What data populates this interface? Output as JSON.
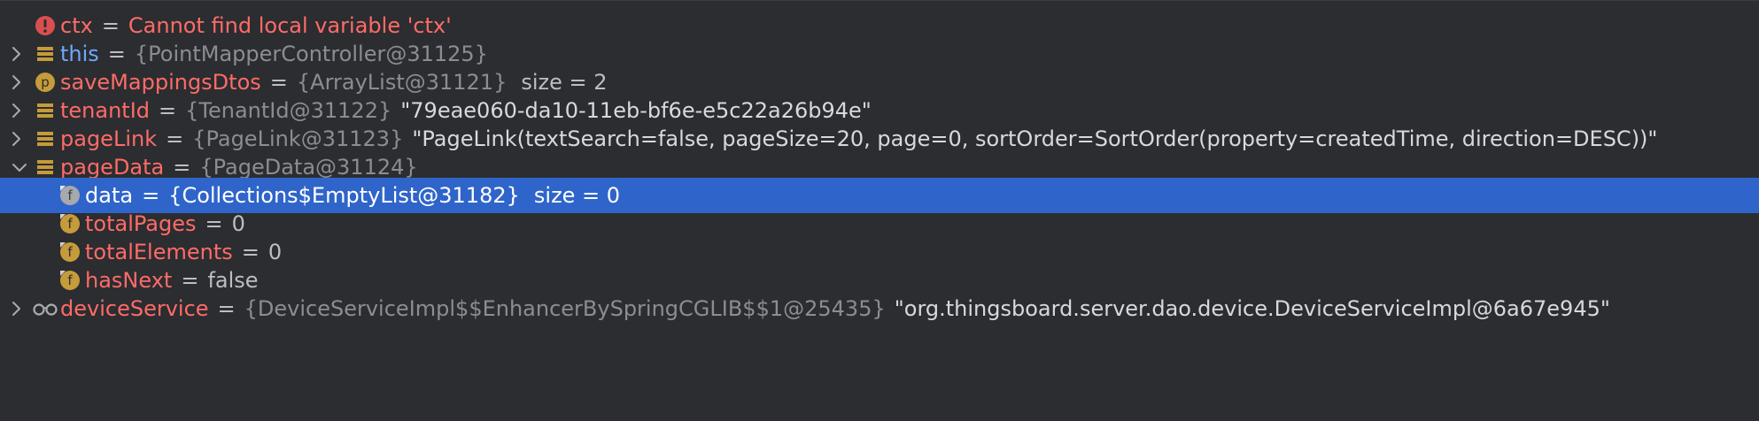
{
  "colors": {
    "background": "#2B2D30",
    "selection": "#2F65CA",
    "variable_name": "#FF6B68",
    "keyword": "#6FA8FF",
    "type_ref": "#8A8D93",
    "error_icon": "#D94F4F",
    "field_icon": "#C69B3A"
  },
  "variables": [
    {
      "name": "ctx",
      "eq": "=",
      "error": "Cannot find local variable 'ctx'",
      "icon": "error-icon"
    },
    {
      "name": "this",
      "eq": "=",
      "type": "{PointMapperController@31125}",
      "icon": "object-icon"
    },
    {
      "name": "saveMappingsDtos",
      "eq": "=",
      "type": "{ArrayList@31121}",
      "size": "size = 2",
      "icon": "parameter-icon",
      "icon_letter": "p"
    },
    {
      "name": "tenantId",
      "eq": "=",
      "type": "{TenantId@31122}",
      "str": "\"79eae060-da10-11eb-bf6e-e5c22a26b94e\"",
      "icon": "object-icon"
    },
    {
      "name": "pageLink",
      "eq": "=",
      "type": "{PageLink@31123}",
      "str": "\"PageLink(textSearch=false, pageSize=20, page=0, sortOrder=SortOrder(property=createdTime, direction=DESC))\"",
      "icon": "object-icon"
    },
    {
      "name": "pageData",
      "eq": "=",
      "type": "{PageData@31124}",
      "icon": "object-icon",
      "expanded": true
    },
    {
      "name": "data",
      "eq": "=",
      "type": "{Collections$EmptyList@31182}",
      "size": "size = 0",
      "icon": "field-icon",
      "icon_letter": "f",
      "selected": true
    },
    {
      "name": "totalPages",
      "eq": "=",
      "value": "0",
      "icon": "field-icon",
      "icon_letter": "f"
    },
    {
      "name": "totalElements",
      "eq": "=",
      "value": "0",
      "icon": "field-icon",
      "icon_letter": "f"
    },
    {
      "name": "hasNext",
      "eq": "=",
      "value": "false",
      "icon": "field-icon",
      "icon_letter": "f"
    },
    {
      "name": "deviceService",
      "eq": "=",
      "type": "{DeviceServiceImpl$$EnhancerBySpringCGLIB$$1@25435}",
      "str": "\"org.thingsboard.server.dao.device.DeviceServiceImpl@6a67e945\"",
      "icon": "watch-glasses-icon"
    }
  ]
}
